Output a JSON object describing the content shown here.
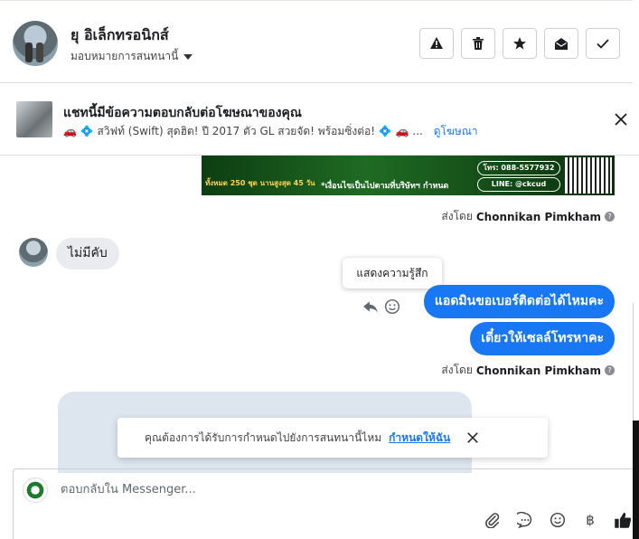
{
  "header": {
    "contact_name": "ยุ อิเล็กทรอนิกส์",
    "assign_label": "มอบหมายการสนทนานี้",
    "actions": [
      {
        "name": "report-spam-button",
        "icon": "warning-icon"
      },
      {
        "name": "delete-button",
        "icon": "trash-icon"
      },
      {
        "name": "star-button",
        "icon": "star-icon"
      },
      {
        "name": "mark-unread-button",
        "icon": "envelope-open-icon"
      },
      {
        "name": "mark-done-button",
        "icon": "check-icon"
      }
    ]
  },
  "ad": {
    "title": "แชทนี้มีข้อความตอบกลับต่อโฆษณาของคุณ",
    "subtitle": "🚗 💠 สวิฟท์ (Swift) สุดฮิต! ปี 2017 ตัว GL สวยจัด! พร้อมซิ่งต่อ! 💠 🚗 ...",
    "link": "ดูโฆษณา"
  },
  "banner": {
    "left_text": "ทั้งหมด 250 ชุด  นานสูงสุด 45 วัน",
    "mid_text": "*เงื่อนไขเป็นไปตามที่บริษัทฯ กำหนด",
    "phone": "โทร: 088-5577932",
    "line": "LINE: @ckcud"
  },
  "messages": {
    "sent_by_label": "ส่งโดย",
    "sender_name": "Chonnikan Pimkham",
    "incoming": "ไม่มีคับ",
    "outgoing_1": "แอดมินขอเบอร์ติดต่อได้ไหมคะ",
    "outgoing_2": "เดี๋ยวให้เซลล์โทรหาคะ",
    "tooltip": "แสดงความรู้สึก"
  },
  "toast": {
    "text": "คุณต้องการได้รับการกำหนดไปยังการสนทนานี้ไหม",
    "link": "กำหนดให้ฉัน"
  },
  "composer": {
    "placeholder": "ตอบกลับใน Messenger...",
    "currency_symbol": "฿"
  },
  "colors": {
    "accent": "#1877f2",
    "bubble_in": "#e9ebee"
  }
}
